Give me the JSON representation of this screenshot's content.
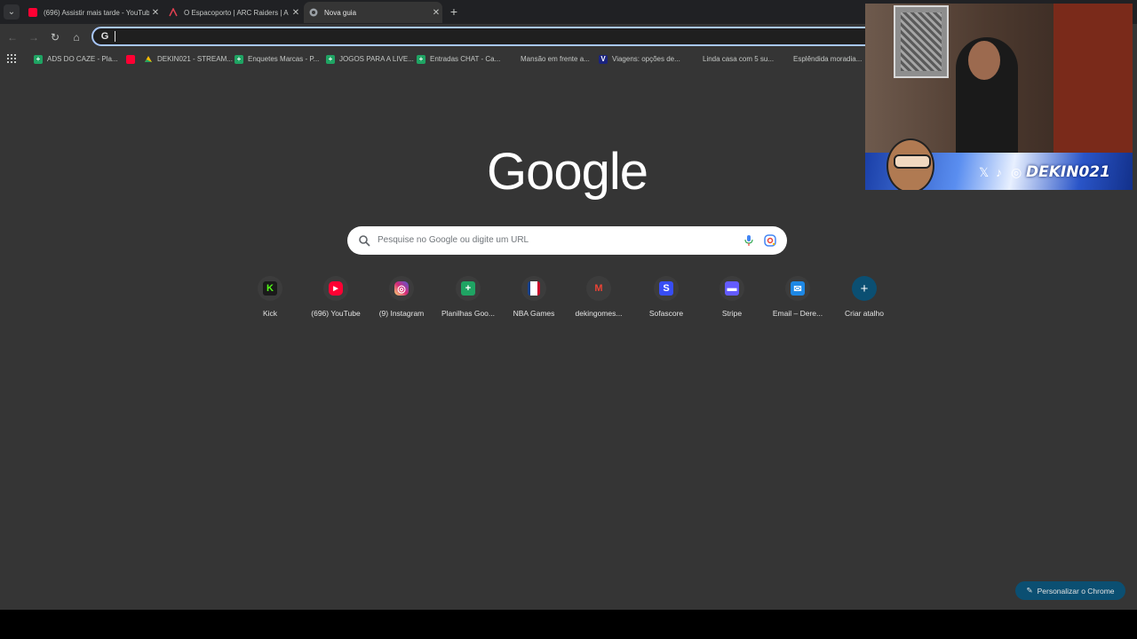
{
  "tabs": [
    {
      "title": "(696) Assistir mais tarde - YouTube",
      "active": false,
      "favicon": "youtube-icon",
      "color": "#ff0033"
    },
    {
      "title": "O Espacoporto | ARC Raiders | A",
      "active": false,
      "favicon": "arc-raiders-icon",
      "color": "#c4c7c5"
    },
    {
      "title": "Nova guia",
      "active": true,
      "favicon": "chrome-icon",
      "color": "#c4c7c5"
    }
  ],
  "omnibox": {
    "value": ""
  },
  "bookmarks": [
    {
      "label": "ADS DO CAZE - Pla...",
      "favicon": "sheets-icon",
      "color": "#1fa463"
    },
    {
      "label": "",
      "favicon": "youtube-icon",
      "color": "#ff0033"
    },
    {
      "label": "DEKIN021 - STREAM...",
      "favicon": "drive-icon",
      "color": "#ffba00"
    },
    {
      "label": "Enquetes Marcas - P...",
      "favicon": "sheets-icon",
      "color": "#1fa463"
    },
    {
      "label": "JOGOS PARA A LIVE...",
      "favicon": "sheets-icon",
      "color": "#1fa463"
    },
    {
      "label": "Entradas CHAT - Ca...",
      "favicon": "sheets-icon",
      "color": "#1fa463"
    },
    {
      "label": "Mansão em frente a...",
      "favicon": "",
      "color": ""
    },
    {
      "label": "Viagens: opções de...",
      "favicon": "flag-icon",
      "color": "#1a237e"
    },
    {
      "label": "Linda casa com 5 su...",
      "favicon": "",
      "color": ""
    },
    {
      "label": "Esplêndida moradia...",
      "favicon": "",
      "color": ""
    }
  ],
  "logo": "Google",
  "search": {
    "placeholder": "Pesquise no Google ou digite um URL"
  },
  "shortcuts": [
    {
      "label": "Kick",
      "icon": "kick-icon",
      "glyph": "K",
      "color": "#53fc18"
    },
    {
      "label": "(696) YouTube",
      "icon": "youtube-icon",
      "glyph": "▶",
      "color": "#ff0033"
    },
    {
      "label": "(9) Instagram",
      "icon": "instagram-icon",
      "glyph": "◎",
      "color": "#d62976"
    },
    {
      "label": "Planilhas Goo...",
      "icon": "sheets-icon",
      "glyph": "▦",
      "color": "#1fa463"
    },
    {
      "label": "NBA Games",
      "icon": "nba-icon",
      "glyph": "▮",
      "color": "#17408b"
    },
    {
      "label": "dekingomes...",
      "icon": "gmail-icon",
      "glyph": "M",
      "color": "#ea4335"
    },
    {
      "label": "Sofascore",
      "icon": "sofascore-icon",
      "glyph": "S",
      "color": "#374df5"
    },
    {
      "label": "Stripe",
      "icon": "stripe-icon",
      "glyph": "▬",
      "color": "#635bff"
    },
    {
      "label": "Email – Dere...",
      "icon": "email-icon",
      "glyph": "✉",
      "color": "#1e88e5"
    },
    {
      "label": "Criar atalho",
      "icon": "add-icon",
      "glyph": "+",
      "color": "#0b4f72"
    }
  ],
  "customize_label": "Personalizar o Chrome",
  "overlay": {
    "handle": "DEKIN021"
  }
}
